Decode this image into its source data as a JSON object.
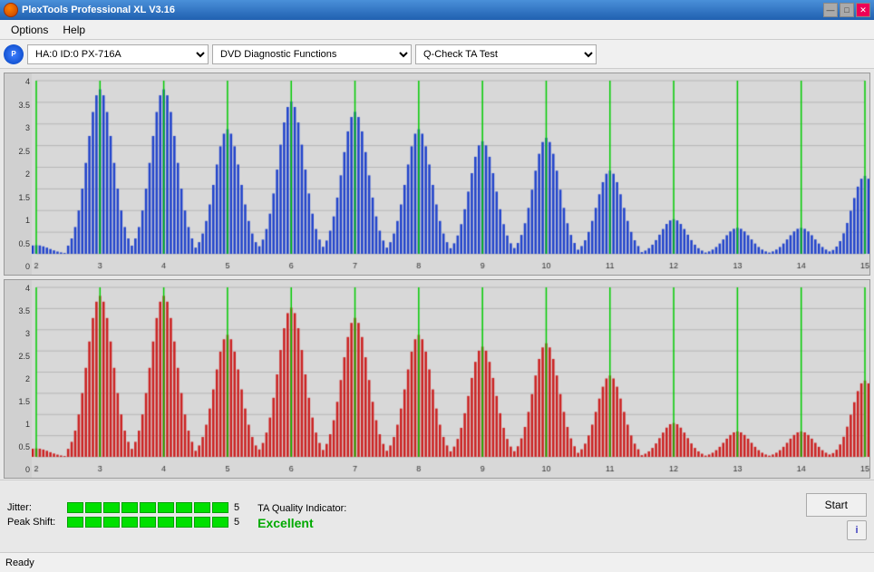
{
  "titlebar": {
    "title": "PlexTools Professional XL V3.16",
    "controls": {
      "minimize": "—",
      "maximize": "□",
      "close": "✕"
    }
  },
  "menubar": {
    "items": [
      "Options",
      "Help"
    ]
  },
  "toolbar": {
    "drive": "HA:0 ID:0  PX-716A",
    "drive_options": [
      "HA:0 ID:0  PX-716A"
    ],
    "function": "DVD Diagnostic Functions",
    "function_options": [
      "DVD Diagnostic Functions"
    ],
    "test": "Q-Check TA Test",
    "test_options": [
      "Q-Check TA Test"
    ]
  },
  "charts": [
    {
      "id": "chart-top",
      "color": "blue",
      "yLabels": [
        "4",
        "3.5",
        "3",
        "2.5",
        "2",
        "1.5",
        "1",
        "0.5",
        "0"
      ],
      "xLabels": [
        "2",
        "3",
        "4",
        "5",
        "6",
        "7",
        "8",
        "9",
        "10",
        "11",
        "12",
        "13",
        "14",
        "15"
      ]
    },
    {
      "id": "chart-bottom",
      "color": "red",
      "yLabels": [
        "4",
        "3.5",
        "3",
        "2.5",
        "2",
        "1.5",
        "1",
        "0.5",
        "0"
      ],
      "xLabels": [
        "2",
        "3",
        "4",
        "5",
        "6",
        "7",
        "8",
        "9",
        "10",
        "11",
        "12",
        "13",
        "14",
        "15"
      ]
    }
  ],
  "metrics": {
    "jitter_label": "Jitter:",
    "jitter_value": "5",
    "jitter_segments": 9,
    "peakshift_label": "Peak Shift:",
    "peakshift_value": "5",
    "peakshift_segments": 9,
    "ta_label": "TA Quality Indicator:",
    "ta_value": "Excellent"
  },
  "buttons": {
    "start": "Start",
    "info": "i"
  },
  "statusbar": {
    "status": "Ready"
  }
}
